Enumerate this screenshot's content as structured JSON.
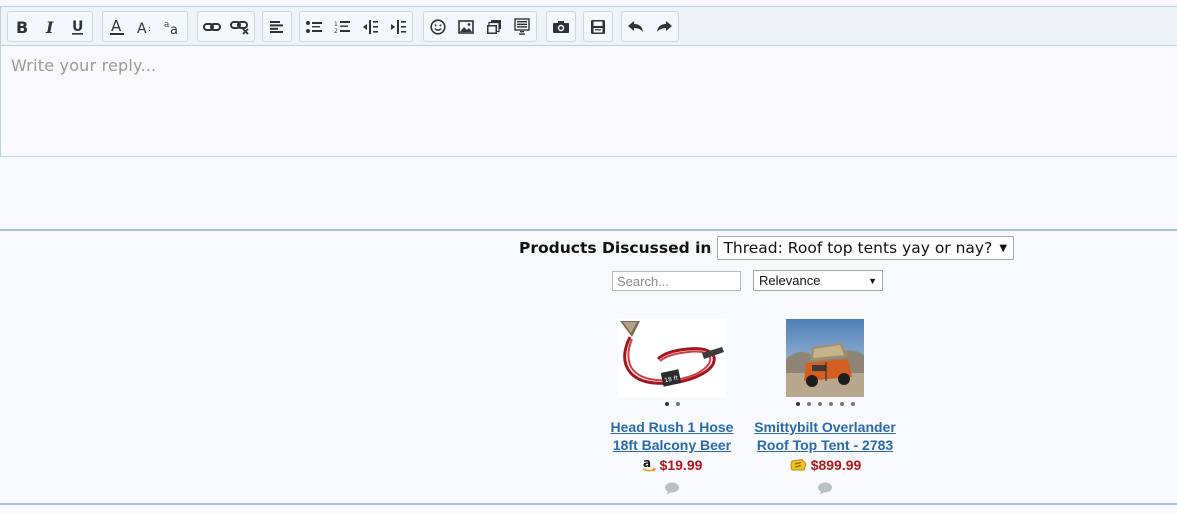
{
  "editor": {
    "placeholder": "Write your reply...",
    "toolbar": [
      {
        "group": "text-style",
        "buttons": [
          "bold-icon",
          "italic-icon",
          "underline-icon"
        ]
      },
      {
        "group": "font",
        "buttons": [
          "text-color-icon",
          "font-size-icon",
          "font-family-icon"
        ]
      },
      {
        "group": "links",
        "buttons": [
          "link-icon",
          "unlink-icon"
        ]
      },
      {
        "group": "align",
        "buttons": [
          "align-left-icon"
        ]
      },
      {
        "group": "lists",
        "buttons": [
          "bulleted-list-icon",
          "numbered-list-icon",
          "outdent-icon",
          "indent-icon"
        ]
      },
      {
        "group": "insert",
        "buttons": [
          "smilie-icon",
          "image-icon",
          "media-icon",
          "quote-icon"
        ]
      },
      {
        "group": "camera",
        "buttons": [
          "camera-icon"
        ]
      },
      {
        "group": "draft",
        "buttons": [
          "save-draft-icon"
        ]
      },
      {
        "group": "history",
        "buttons": [
          "undo-icon",
          "redo-icon"
        ]
      }
    ]
  },
  "products": {
    "title": "Products Discussed in",
    "scope_selected": "Thread: Roof top tents yay or nay?",
    "search_placeholder": "Search...",
    "sort_selected": "Relevance",
    "items": [
      {
        "title_line1": "Head Rush 1 Hose",
        "title_line2": "18ft Balcony Beer",
        "price": "$19.99",
        "store_icon": "amazon-icon",
        "image_count": 2,
        "active_image": 1
      },
      {
        "title_line1": "Smittybilt Overlander",
        "title_line2": "Roof Top Tent - 2783",
        "price": "$899.99",
        "store_icon": "price-tag-icon",
        "image_count": 6,
        "active_image": 1
      }
    ]
  },
  "colors": {
    "link": "#2a6aa8",
    "price": "#b2161b",
    "divider": "#a9c3d6",
    "toolbar_bg": "#eef4f8"
  }
}
